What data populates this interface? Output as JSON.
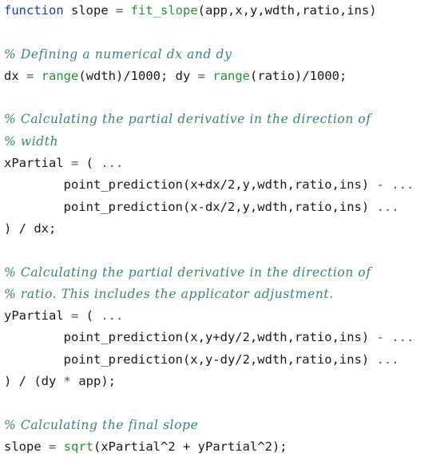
{
  "colors": {
    "keyword": "#1f3f9e",
    "builtin": "#2e8b3a",
    "comment": "#3f7f7f",
    "text": "#1a1a1a",
    "operator": "#555555"
  },
  "lines": [
    [
      {
        "t": "function",
        "c": "kw"
      },
      {
        "t": " slope "
      },
      {
        "t": "=",
        "c": "op"
      },
      {
        "t": " "
      },
      {
        "t": "fit_slope",
        "c": "fn"
      },
      {
        "t": "(app,x,y,wdth,ratio,ins)"
      }
    ],
    [],
    [
      {
        "t": "% Defining a numerical dx and dy",
        "c": "cmt"
      }
    ],
    [
      {
        "t": "dx "
      },
      {
        "t": "=",
        "c": "op"
      },
      {
        "t": " "
      },
      {
        "t": "range",
        "c": "fn"
      },
      {
        "t": "(wdth)/1000; dy "
      },
      {
        "t": "=",
        "c": "op"
      },
      {
        "t": " "
      },
      {
        "t": "range",
        "c": "fn"
      },
      {
        "t": "(ratio)/1000;"
      }
    ],
    [],
    [
      {
        "t": "% Calculating the partial derivative in the direction of",
        "c": "cmt"
      }
    ],
    [
      {
        "t": "% width",
        "c": "cmt"
      }
    ],
    [
      {
        "t": "xPartial "
      },
      {
        "t": "=",
        "c": "op"
      },
      {
        "t": " ( "
      },
      {
        "t": "...",
        "c": "op"
      }
    ],
    [
      {
        "t": "        point_prediction(x+dx/2,y,wdth,ratio,ins) "
      },
      {
        "t": "-",
        "c": "op"
      },
      {
        "t": " "
      },
      {
        "t": "...",
        "c": "op"
      }
    ],
    [
      {
        "t": "        point_prediction(x-dx/2,y,wdth,ratio,ins) "
      },
      {
        "t": "...",
        "c": "op"
      }
    ],
    [
      {
        "t": ") / dx;"
      }
    ],
    [],
    [
      {
        "t": "% Calculating the partial derivative in the direction of",
        "c": "cmt"
      }
    ],
    [
      {
        "t": "% ratio. This includes the applicator adjustment.",
        "c": "cmt"
      }
    ],
    [
      {
        "t": "yPartial "
      },
      {
        "t": "=",
        "c": "op"
      },
      {
        "t": " ( "
      },
      {
        "t": "...",
        "c": "op"
      }
    ],
    [
      {
        "t": "        point_prediction(x,y+dy/2,wdth,ratio,ins) "
      },
      {
        "t": "-",
        "c": "op"
      },
      {
        "t": " "
      },
      {
        "t": "...",
        "c": "op"
      }
    ],
    [
      {
        "t": "        point_prediction(x,y-dy/2,wdth,ratio,ins) "
      },
      {
        "t": "...",
        "c": "op"
      }
    ],
    [
      {
        "t": ") / (dy "
      },
      {
        "t": "*",
        "c": "op"
      },
      {
        "t": " app);"
      }
    ],
    [],
    [
      {
        "t": "% Calculating the final slope",
        "c": "cmt"
      }
    ],
    [
      {
        "t": "slope "
      },
      {
        "t": "=",
        "c": "op"
      },
      {
        "t": " "
      },
      {
        "t": "sqrt",
        "c": "fn"
      },
      {
        "t": "(xPartial^2 + yPartial^2);"
      }
    ]
  ]
}
